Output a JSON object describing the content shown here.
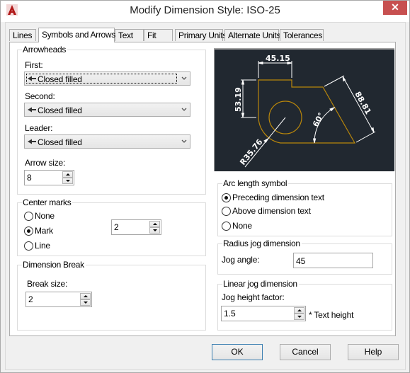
{
  "window": {
    "title": "Modify Dimension Style: ISO-25",
    "close_icon": "close-icon",
    "app_icon": "autocad-logo-icon"
  },
  "tabs": [
    {
      "label": "Lines",
      "active": false
    },
    {
      "label": "Symbols and Arrows",
      "active": true
    },
    {
      "label": "Text",
      "active": false
    },
    {
      "label": "Fit",
      "active": false
    },
    {
      "label": "Primary Units",
      "active": false
    },
    {
      "label": "Alternate Units",
      "active": false
    },
    {
      "label": "Tolerances",
      "active": false
    }
  ],
  "arrowheads": {
    "title": "Arrowheads",
    "first_label": "First:",
    "first_value": "Closed filled",
    "second_label": "Second:",
    "second_value": "Closed filled",
    "leader_label": "Leader:",
    "leader_value": "Closed filled",
    "arrow_size_label": "Arrow size:",
    "arrow_size_value": "8"
  },
  "center_marks": {
    "title": "Center marks",
    "options": [
      {
        "label": "None",
        "selected": false
      },
      {
        "label": "Mark",
        "selected": true
      },
      {
        "label": "Line",
        "selected": false
      }
    ],
    "size_value": "2"
  },
  "dimension_break": {
    "title": "Dimension Break",
    "break_size_label": "Break size:",
    "break_size_value": "2"
  },
  "preview": {
    "dim_horizontal": "45.15",
    "dim_vertical": "53.19",
    "dim_aligned": "88.81",
    "dim_angle": "60°",
    "dim_radius": "R35.76",
    "colors": {
      "background": "#212830",
      "geometry": "#b8860b",
      "dimension": "#ffffff"
    }
  },
  "arc_length": {
    "title": "Arc length symbol",
    "options": [
      {
        "label": "Preceding dimension text",
        "selected": true
      },
      {
        "label": "Above dimension text",
        "selected": false
      },
      {
        "label": "None",
        "selected": false
      }
    ]
  },
  "radius_jog": {
    "title": "Radius jog dimension",
    "jog_angle_label": "Jog angle:",
    "jog_angle_value": "45"
  },
  "linear_jog": {
    "title": "Linear jog dimension",
    "height_factor_label": "Jog height factor:",
    "height_factor_value": "1.5",
    "suffix": "* Text height"
  },
  "buttons": {
    "ok": "OK",
    "cancel": "Cancel",
    "help": "Help"
  }
}
